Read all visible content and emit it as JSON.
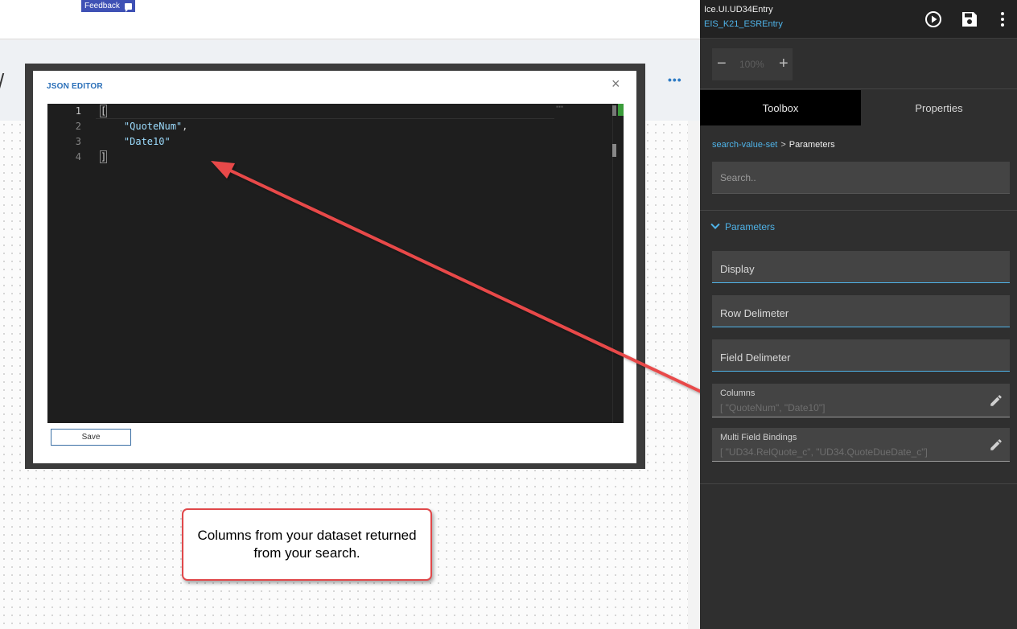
{
  "topbar": {
    "feedback_label": "Feedback"
  },
  "modal": {
    "title": "JSON EDITOR",
    "close_glyph": "×",
    "save_label": "Save",
    "line_numbers": [
      "1",
      "2",
      "3",
      "4"
    ],
    "code": {
      "line1": "[",
      "line2_str": "\"QuoteNum\"",
      "line2_punc": ",",
      "line3_str": "\"Date10\"",
      "line4": "]"
    }
  },
  "annotation": {
    "text": "Columns from your dataset returned from your search."
  },
  "right_panel": {
    "app_name": "Ice.UI.UD34Entry",
    "app_sub": "EIS_K21_ESREntry",
    "zoom": {
      "value": "100%",
      "minus": "−",
      "plus": "+"
    },
    "tabs": {
      "toolbox": "Toolbox",
      "properties": "Properties"
    },
    "breadcrumb": {
      "link": "search-value-set",
      "sep": ">",
      "current": "Parameters"
    },
    "search_placeholder": "Search..",
    "section_title": "Parameters",
    "fields": {
      "display": "Display",
      "row_delimeter": "Row Delimeter",
      "field_delimeter": "Field Delimeter",
      "columns_label": "Columns",
      "columns_value": "[  \"QuoteNum\",  \"Date10\"]",
      "mfb_label": "Multi Field Bindings",
      "mfb_value": "[  \"UD34.RelQuote_c\",  \"UD34.QuoteDueDate_c\"]"
    }
  },
  "colors": {
    "accent": "#4fb3e8",
    "callout_border": "#e0484a",
    "feedback_bg": "#3f51b5"
  },
  "icons": [
    "play-icon",
    "save-icon",
    "kebab-menu-icon",
    "close-icon",
    "chevron-down-icon",
    "pencil-icon",
    "feedback-icon"
  ]
}
